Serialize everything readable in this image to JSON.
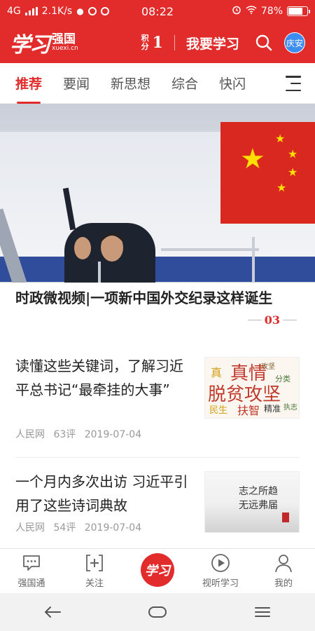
{
  "status_bar": {
    "network": "4G",
    "speed": "2.1K/s",
    "time": "08:22",
    "battery": "78%",
    "battery_level": 0.78
  },
  "header": {
    "logo_main": "学习",
    "logo_sub": "强国",
    "logo_domain": "xuexi.cn",
    "score_label_1": "积",
    "score_label_2": "分",
    "score_value": "1",
    "study_label": "我要学习",
    "avatar_text": "庆安"
  },
  "tabs": [
    {
      "label": "推荐",
      "active": true
    },
    {
      "label": "要闻",
      "active": false
    },
    {
      "label": "新思想",
      "active": false
    },
    {
      "label": "综合",
      "active": false
    },
    {
      "label": "快闪",
      "active": false
    }
  ],
  "hero": {
    "title": "时政微视频|一项新中国外交纪录这样诞生",
    "page_number": "03"
  },
  "news": [
    {
      "title": "读懂这些关键词，了解习近平总书记“最牵挂的大事”",
      "source": "人民网",
      "comments": "63评",
      "date": "2019-07-04",
      "thumb_words": [
        "真情",
        "真",
        "脱贫攻坚",
        "分类",
        "民生",
        "扶智",
        "精准",
        "执志",
        "攻坚"
      ]
    },
    {
      "title": "一个月内多次出访 习近平引用了这些诗词典故",
      "source": "人民网",
      "comments": "54评",
      "date": "2019-07-04",
      "thumb_poem_1": "志之所趋",
      "thumb_poem_2": "无远弗届"
    }
  ],
  "bottom_nav": [
    {
      "label": "强国通",
      "icon": "chat-icon"
    },
    {
      "label": "关注",
      "icon": "add-follow-icon"
    },
    {
      "label": "学习",
      "icon": "xuexi-logo-icon"
    },
    {
      "label": "视听学习",
      "icon": "play-icon"
    },
    {
      "label": "我的",
      "icon": "user-icon"
    }
  ],
  "colors": {
    "brand_red": "#e22c2c",
    "avatar_blue": "#3d8cf0"
  }
}
